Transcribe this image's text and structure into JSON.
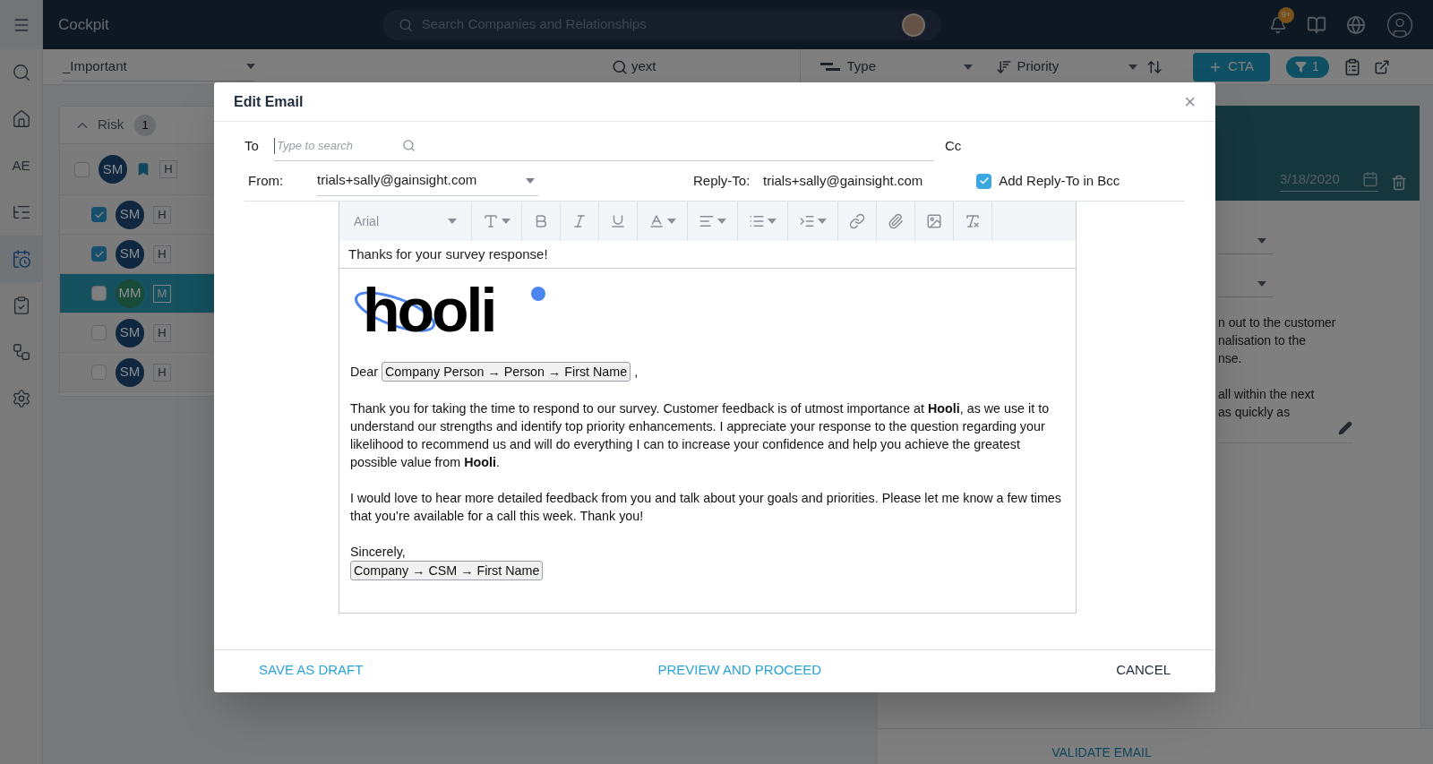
{
  "sidebar": {
    "items": [
      {
        "kind": "icon",
        "selected": false
      },
      {
        "kind": "icon",
        "selected": false
      },
      {
        "kind": "text",
        "label": "AE",
        "selected": false
      },
      {
        "kind": "icon",
        "selected": false
      },
      {
        "kind": "icon",
        "selected": true
      },
      {
        "kind": "icon",
        "selected": false
      },
      {
        "kind": "icon",
        "selected": false
      },
      {
        "kind": "icon",
        "selected": false
      }
    ]
  },
  "top_bar": {
    "title": "Cockpit",
    "search_placeholder": "Search Companies and Relationships",
    "notification_badge": "9+"
  },
  "filter_bar": {
    "view": "_Important",
    "search": "yext",
    "type": "Type",
    "priority": "Priority",
    "cta_button": "CTA",
    "filter_count": "1"
  },
  "risk_table": {
    "group": "Risk",
    "group_count": "1",
    "rows": [
      {
        "checked": false,
        "selected": false,
        "avatar": "SM",
        "color": "#10283f",
        "bookmarked": true,
        "tag": "H"
      },
      {
        "checked": true,
        "selected": false,
        "avatar": "SM",
        "color": "#10283f",
        "bookmarked": false,
        "tag": "H"
      },
      {
        "checked": true,
        "selected": false,
        "avatar": "SM",
        "color": "#10283f",
        "bookmarked": false,
        "tag": "H"
      },
      {
        "checked": false,
        "selected": true,
        "avatar": "MM",
        "color": "#1a4a38",
        "bookmarked": false,
        "tag": "M"
      },
      {
        "checked": false,
        "selected": false,
        "avatar": "SM",
        "color": "#10283f",
        "bookmarked": false,
        "tag": "H"
      },
      {
        "checked": false,
        "selected": false,
        "avatar": "SM",
        "color": "#10283f",
        "bookmarked": false,
        "tag": "H"
      }
    ]
  },
  "detail_panel": {
    "due_date": "3/18/2020",
    "text_lines": [
      "n out to the customer",
      "nalisation to the",
      "nse.",
      "all within the next",
      "as quickly as"
    ],
    "validate_button": "VALIDATE EMAIL"
  },
  "dialog": {
    "title": "Edit Email",
    "close": "×",
    "to_label": "To",
    "to_placeholder": "Type to search",
    "cc_label": "Cc",
    "from_label": "From:",
    "from_value": "trials+sally@gainsight.com",
    "reply_to_label": "Reply-To:",
    "reply_to_value": "trials+sally@gainsight.com",
    "bcc_checkbox": {
      "label": "Add Reply-To in Bcc",
      "checked": true
    },
    "font": "Arial",
    "subject": "Thanks for your survey response!",
    "logo": "hooli",
    "greeting": "Dear",
    "greeting_token": "Company Person → Person → First Name",
    "greeting_end": ",",
    "paragraphs": [
      "Thank you for taking the time to respond to our survey. Customer feedback is of utmost importance at **Hooli**, as we use it to understand our strengths and identify top priority enhancements. I appreciate your response to the question regarding your likelihood to recommend us and will do everything I can to increase your confidence and help you achieve the greatest possible value from **Hooli**.",
      "I would love to hear more detailed feedback from you and talk about your goals and priorities. Please let me know a few times that you’re available for a call this week. Thank you!"
    ],
    "closing": "Sincerely,",
    "signature_token": "Company → CSM → First Name",
    "buttons": [
      {
        "label": "SAVE AS DRAFT",
        "kind": "link"
      },
      {
        "label": "PREVIEW AND PROCEED",
        "kind": "link"
      },
      {
        "label": "CANCEL",
        "kind": "plain"
      }
    ]
  }
}
